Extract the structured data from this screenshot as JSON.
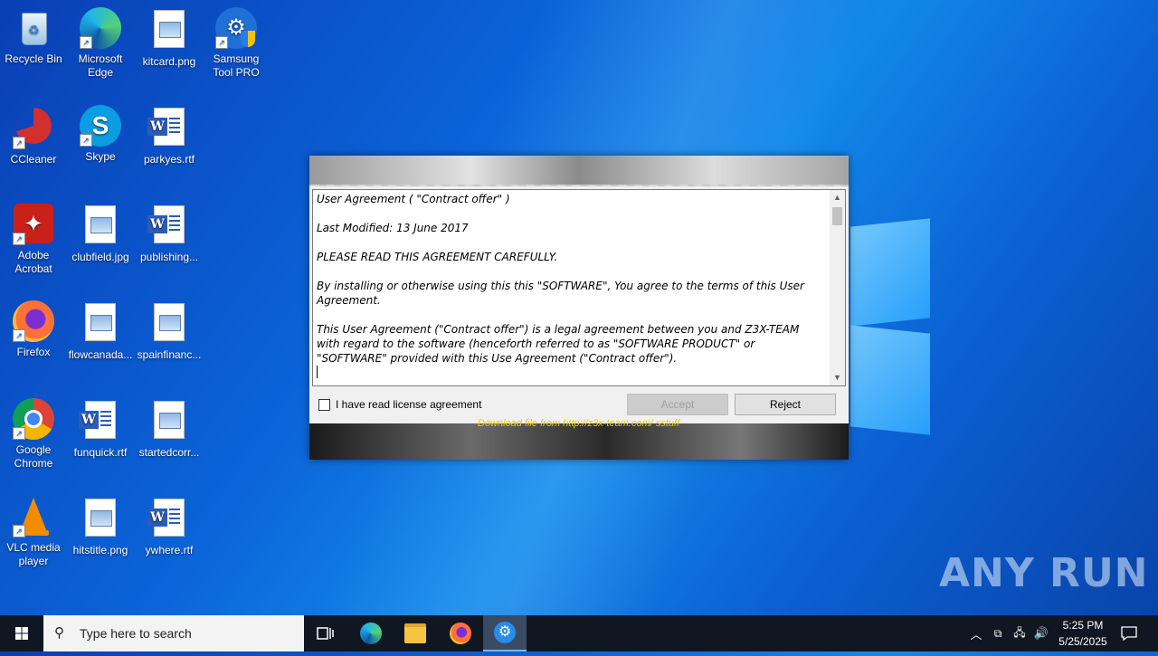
{
  "desktop": {
    "icons": [
      {
        "label": "Recycle Bin"
      },
      {
        "label": "Microsoft Edge"
      },
      {
        "label": "kitcard.png"
      },
      {
        "label": "Samsung Tool PRO"
      },
      {
        "label": "CCleaner"
      },
      {
        "label": "Skype"
      },
      {
        "label": "parkyes.rtf"
      },
      {
        "label": "Adobe Acrobat"
      },
      {
        "label": "clubfield.jpg"
      },
      {
        "label": "publishing..."
      },
      {
        "label": "Firefox"
      },
      {
        "label": "flowcanada..."
      },
      {
        "label": "spainfinanc..."
      },
      {
        "label": "Google Chrome"
      },
      {
        "label": "funquick.rtf"
      },
      {
        "label": "startedcorr..."
      },
      {
        "label": "VLC media player"
      },
      {
        "label": "hitstitle.png"
      },
      {
        "label": "ywhere.rtf"
      }
    ]
  },
  "installer": {
    "agreement": {
      "title": "User Agreement  ( \"Contract offer\" )",
      "modified": "Last Modified: 13 June 2017",
      "read_carefully": "PLEASE READ THIS AGREEMENT CAREFULLY.",
      "para1": "By installing or otherwise using this this \"SOFTWARE\",  You agree to the terms of this User Agreement.",
      "para2": "This  User  Agreement (\"Contract offer\") is a legal agreement between you and Z3X-TEAM  with regard to the software (henceforth referred to as \"SOFTWARE PRODUCT\" or \"SOFTWARE\" provided with this Use Agreement (\"Contract offer\")."
    },
    "checkbox_label": "I have read license agreement",
    "checkbox_checked": false,
    "accept_label": "Accept",
    "reject_label": "Reject",
    "bottom_text": "Download file from http://z3x-team.com/ sstuff"
  },
  "taskbar": {
    "search_placeholder": "Type here to search",
    "time": "5:25 PM",
    "date": "5/25/2025"
  },
  "watermark": "ANY RUN"
}
